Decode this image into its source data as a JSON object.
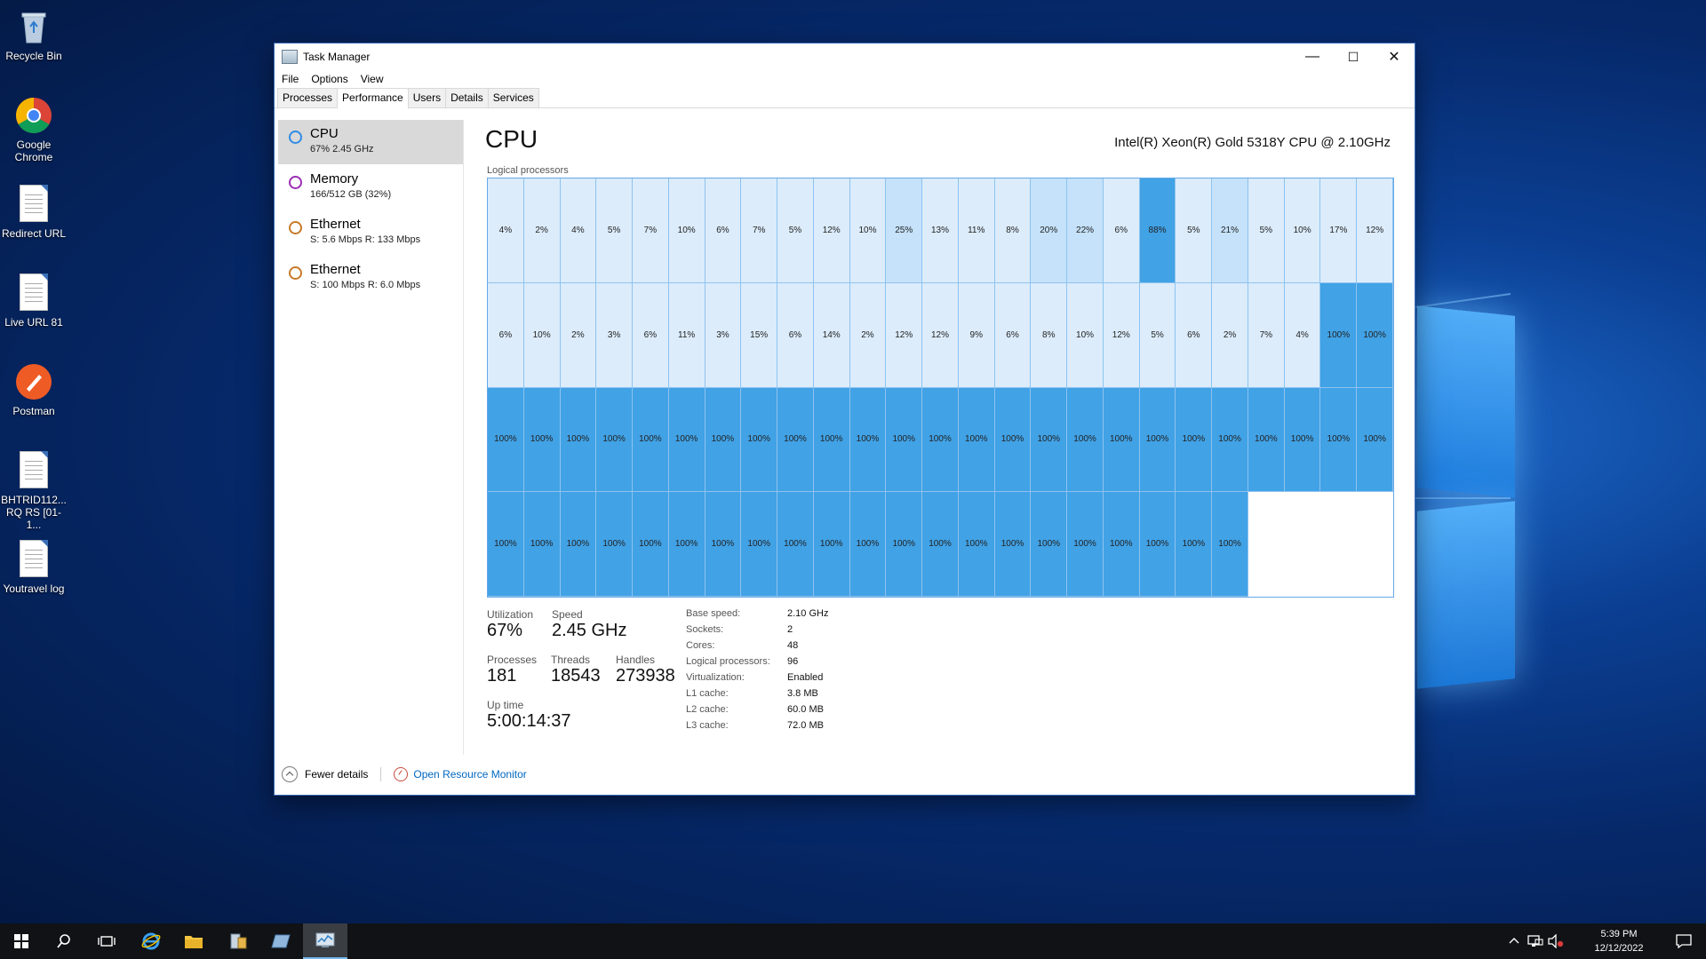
{
  "desktop": {
    "icons": [
      {
        "label": "Recycle Bin",
        "icon": "recycle-bin-icon"
      },
      {
        "label": "Google Chrome",
        "icon": "chrome-icon"
      },
      {
        "label": "Redirect URL",
        "icon": "document-icon"
      },
      {
        "label": "Live URL 81",
        "icon": "document-icon"
      },
      {
        "label": "Postman",
        "icon": "postman-icon"
      },
      {
        "label": "BHTRID112... RQ RS [01-1...",
        "icon": "document-icon"
      },
      {
        "label": "Youtravel log",
        "icon": "document-icon"
      }
    ]
  },
  "window": {
    "title": "Task Manager",
    "controls": {
      "minimize": "—",
      "maximize": "☐",
      "close": "✕"
    },
    "menu": [
      "File",
      "Options",
      "View"
    ],
    "tabs": [
      {
        "label": "Processes",
        "active": false
      },
      {
        "label": "Performance",
        "active": true
      },
      {
        "label": "Users",
        "active": false
      },
      {
        "label": "Details",
        "active": false
      },
      {
        "label": "Services",
        "active": false
      }
    ]
  },
  "sidebar": {
    "items": [
      {
        "name": "CPU",
        "sub": "67%  2.45 GHz",
        "color": "#2f8ce4",
        "selected": true
      },
      {
        "name": "Memory",
        "sub": "166/512 GB (32%)",
        "color": "#9b2fb5",
        "selected": false
      },
      {
        "name": "Ethernet",
        "sub": "S: 5.6 Mbps  R: 133 Mbps",
        "color": "#c87a2a",
        "selected": false
      },
      {
        "name": "Ethernet",
        "sub": "S: 100 Mbps  R: 6.0 Mbps",
        "color": "#c87a2a",
        "selected": false
      }
    ]
  },
  "main": {
    "title": "CPU",
    "model": "Intel(R) Xeon(R) Gold 5318Y CPU @ 2.10GHz",
    "logical_label": "Logical processors",
    "processors": [
      [
        4,
        2,
        4,
        5,
        7,
        10,
        6,
        7,
        5,
        12,
        10,
        25,
        13,
        11,
        8,
        20,
        22,
        6,
        88,
        5,
        21,
        5,
        10,
        17,
        12
      ],
      [
        6,
        10,
        2,
        3,
        6,
        11,
        3,
        15,
        6,
        14,
        2,
        12,
        12,
        9,
        6,
        8,
        10,
        12,
        5,
        6,
        2,
        7,
        4,
        100,
        100
      ],
      [
        100,
        100,
        100,
        100,
        100,
        100,
        100,
        100,
        100,
        100,
        100,
        100,
        100,
        100,
        100,
        100,
        100,
        100,
        100,
        100,
        100,
        100,
        100,
        100,
        100
      ],
      [
        100,
        100,
        100,
        100,
        100,
        100,
        100,
        100,
        100,
        100,
        100,
        100,
        100,
        100,
        100,
        100,
        100,
        100,
        100,
        100,
        100
      ]
    ],
    "colors": {
      "low": "#dcecfb",
      "mid": "#c5e2fa",
      "high": "#41a2e6"
    },
    "stats": {
      "utilization_label": "Utilization",
      "utilization": "67%",
      "speed_label": "Speed",
      "speed": "2.45 GHz",
      "processes_label": "Processes",
      "processes": "181",
      "threads_label": "Threads",
      "threads": "18543",
      "handles_label": "Handles",
      "handles": "273938",
      "uptime_label": "Up time",
      "uptime": "5:00:14:37"
    },
    "specs": [
      {
        "k": "Base speed:",
        "v": "2.10 GHz"
      },
      {
        "k": "Sockets:",
        "v": "2"
      },
      {
        "k": "Cores:",
        "v": "48"
      },
      {
        "k": "Logical processors:",
        "v": "96"
      },
      {
        "k": "Virtualization:",
        "v": "Enabled"
      },
      {
        "k": "L1 cache:",
        "v": "3.8 MB"
      },
      {
        "k": "L2 cache:",
        "v": "60.0 MB"
      },
      {
        "k": "L3 cache:",
        "v": "72.0 MB"
      }
    ]
  },
  "footer": {
    "fewer_details": "Fewer details",
    "resource_monitor": "Open Resource Monitor"
  },
  "taskbar": {
    "time": "5:39 PM",
    "date": "12/12/2022"
  }
}
